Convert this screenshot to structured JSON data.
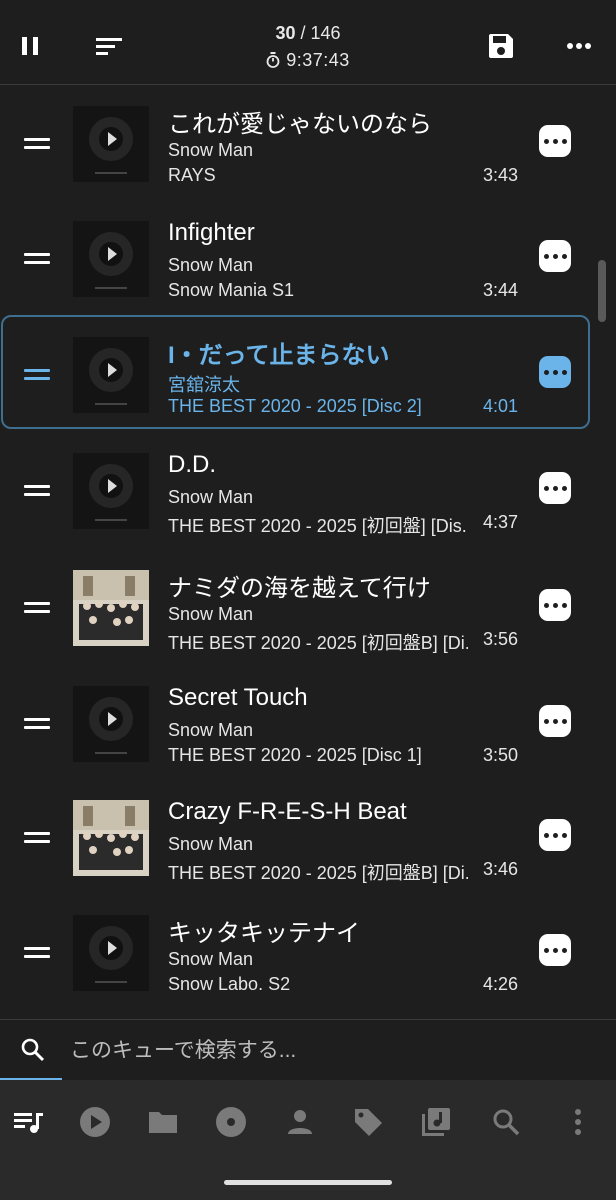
{
  "header": {
    "position": "30",
    "separator": "/",
    "total": "146",
    "elapsed": "9:37:43"
  },
  "queue": [
    {
      "title": "これが愛じゃないのなら",
      "artist": "Snow Man",
      "album": "RAYS",
      "duration": "3:43",
      "art": "default",
      "current": false
    },
    {
      "title": "Infighter",
      "artist": "Snow Man",
      "album": "Snow Mania S1",
      "duration": "3:44",
      "art": "default",
      "current": false
    },
    {
      "title": "I・だって止まらない",
      "artist": "宮舘涼太",
      "album": "THE BEST 2020 - 2025 [Disc 2]",
      "duration": "4:01",
      "art": "default",
      "current": true
    },
    {
      "title": "D.D.",
      "artist": "Snow Man",
      "album": "THE BEST 2020 - 2025 [初回盤] [Dis..",
      "duration": "4:37",
      "art": "default",
      "current": false
    },
    {
      "title": "ナミダの海を越えて行け",
      "artist": "Snow Man",
      "album": "THE BEST 2020 - 2025 [初回盤B] [Di..",
      "duration": "3:56",
      "art": "photo",
      "current": false
    },
    {
      "title": "Secret Touch",
      "artist": "Snow Man",
      "album": "THE BEST 2020 - 2025 [Disc 1]",
      "duration": "3:50",
      "art": "default",
      "current": false
    },
    {
      "title": "Crazy F-R-E-S-H Beat",
      "artist": "Snow Man",
      "album": "THE BEST 2020 - 2025 [初回盤B] [Di..",
      "duration": "3:46",
      "art": "photo",
      "current": false
    },
    {
      "title": "キッタキッテナイ",
      "artist": "Snow Man",
      "album": "Snow Labo. S2",
      "duration": "4:26",
      "art": "default",
      "current": false
    }
  ],
  "search": {
    "placeholder": "このキューで検索する..."
  },
  "nav": {
    "items": [
      "queue-icon",
      "play-icon",
      "folder-icon",
      "album-icon",
      "artist-icon",
      "tag-icon",
      "playlist-icon",
      "search-icon",
      "more-vert-icon"
    ],
    "active": "queue-icon"
  },
  "colors": {
    "background": "#1e1e1e",
    "accent": "#6ab4ea",
    "nav_background": "#2a2a2a"
  }
}
